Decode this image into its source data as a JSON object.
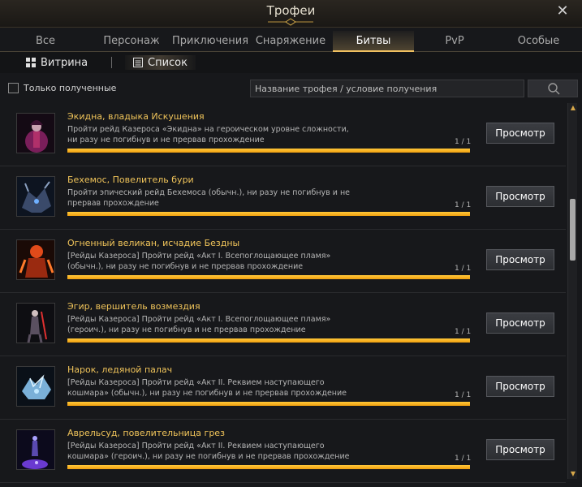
{
  "window": {
    "title": "Трофеи"
  },
  "tabs": [
    {
      "label": "Все"
    },
    {
      "label": "Персонаж"
    },
    {
      "label": "Приключения"
    },
    {
      "label": "Снаряжение"
    },
    {
      "label": "Битвы"
    },
    {
      "label": "PvP"
    },
    {
      "label": "Особые"
    }
  ],
  "view": {
    "showcase_label": "Витрина",
    "list_label": "Список"
  },
  "filter": {
    "only_obtained_label": "Только полученные",
    "search_placeholder": "Название трофея / условие получения"
  },
  "rows": [
    {
      "name": "Экидна, владыка Искушения",
      "desc": "Пройти рейд Казероса «Экидна» на героическом уровне сложности, ни разу не погибнув и не прервав прохождение",
      "count": "1 / 1",
      "progress": 1.0,
      "button": "Просмотр",
      "icon": "echidna-portrait"
    },
    {
      "name": "Бехемос, Повелитель бури",
      "desc": "Пройти эпический рейд Бехемоса (обычн.), ни разу не погибнув и не прервав прохождение",
      "count": "1 / 1",
      "progress": 1.0,
      "button": "Просмотр",
      "icon": "behemoth-portrait"
    },
    {
      "name": "Огненный великан, исчадие Бездны",
      "desc": "[Рейды Казероса] Пройти рейд «Акт I. Всепоглощающее пламя» (обычн.), ни разу не погибнув и не прервав прохождение",
      "count": "1 / 1",
      "progress": 1.0,
      "button": "Просмотр",
      "icon": "fire-giant-portrait"
    },
    {
      "name": "Эгир, вершитель возмездия",
      "desc": "[Рейды Казероса] Пройти рейд «Акт I. Всепоглощающее пламя» (героич.), ни разу не погибнув и не прервав прохождение",
      "count": "1 / 1",
      "progress": 1.0,
      "button": "Просмотр",
      "icon": "aegir-portrait"
    },
    {
      "name": "Нарок, ледяной палач",
      "desc": "[Рейды Казероса] Пройти рейд «Акт II. Реквием наступающего кошмара» (обычн.), ни разу не погибнув и не прервав прохождение",
      "count": "1 / 1",
      "progress": 1.0,
      "button": "Просмотр",
      "icon": "narok-portrait"
    },
    {
      "name": "Аврельсуд, повелительница грез",
      "desc": "[Рейды Казероса] Пройти рейд «Акт II. Реквием наступающего кошмара» (героич.), ни разу не погибнув и не прервав прохождение",
      "count": "1 / 1",
      "progress": 1.0,
      "button": "Просмотр",
      "icon": "aurelsud-portrait"
    }
  ],
  "colors": {
    "accent": "#f0c45a",
    "progress": "#ffb020"
  }
}
